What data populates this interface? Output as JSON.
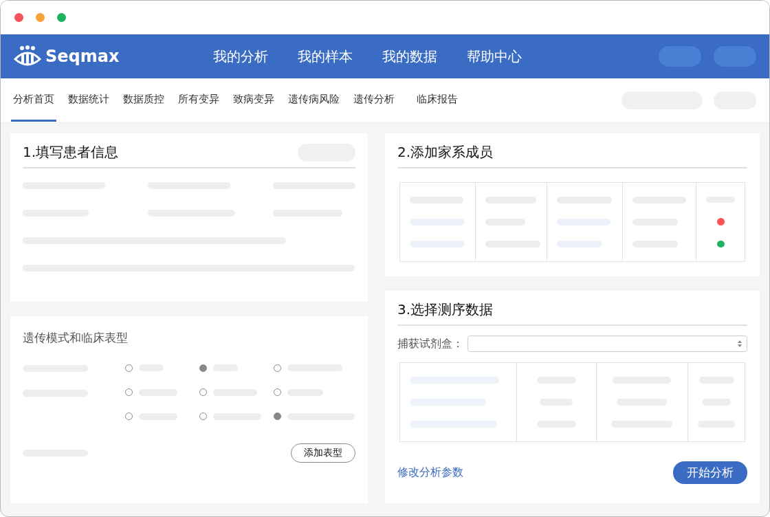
{
  "header": {
    "logo": "Seqmax",
    "nav": [
      "我的分析",
      "我的样本",
      "我的数据",
      "帮助中心"
    ]
  },
  "tabs": [
    {
      "label": "分析首页",
      "selected": true
    },
    {
      "label": "数据统计",
      "selected": false
    },
    {
      "label": "数据质控",
      "selected": false
    },
    {
      "label": "所有变异",
      "selected": false
    },
    {
      "label": "致病变异",
      "selected": false
    },
    {
      "label": "遗传病风险",
      "selected": false
    },
    {
      "label": "遗传分析",
      "selected": false
    },
    {
      "label": "临床报告",
      "selected": false
    }
  ],
  "patient": {
    "title": "1.填写患者信息"
  },
  "phenotype": {
    "title": "遗传模式和临床表型",
    "groups": [
      {
        "options": [
          {
            "selected": false
          },
          {
            "selected": true
          },
          {
            "selected": false
          }
        ]
      },
      {
        "options": [
          {
            "selected": false
          },
          {
            "selected": false
          },
          {
            "selected": false
          },
          {
            "selected": false
          },
          {
            "selected": false
          },
          {
            "selected": true
          }
        ]
      }
    ],
    "add_button": "添加表型"
  },
  "family": {
    "title": "2.添加家系成员",
    "status_dots": [
      {
        "color": "#ff5252"
      },
      {
        "color": "#20b060"
      }
    ]
  },
  "sequencing": {
    "title": "3.选择测序数据",
    "kit_label": "捕获试剂盒：",
    "link": "修改分析参数",
    "start_button": "开始分析"
  }
}
